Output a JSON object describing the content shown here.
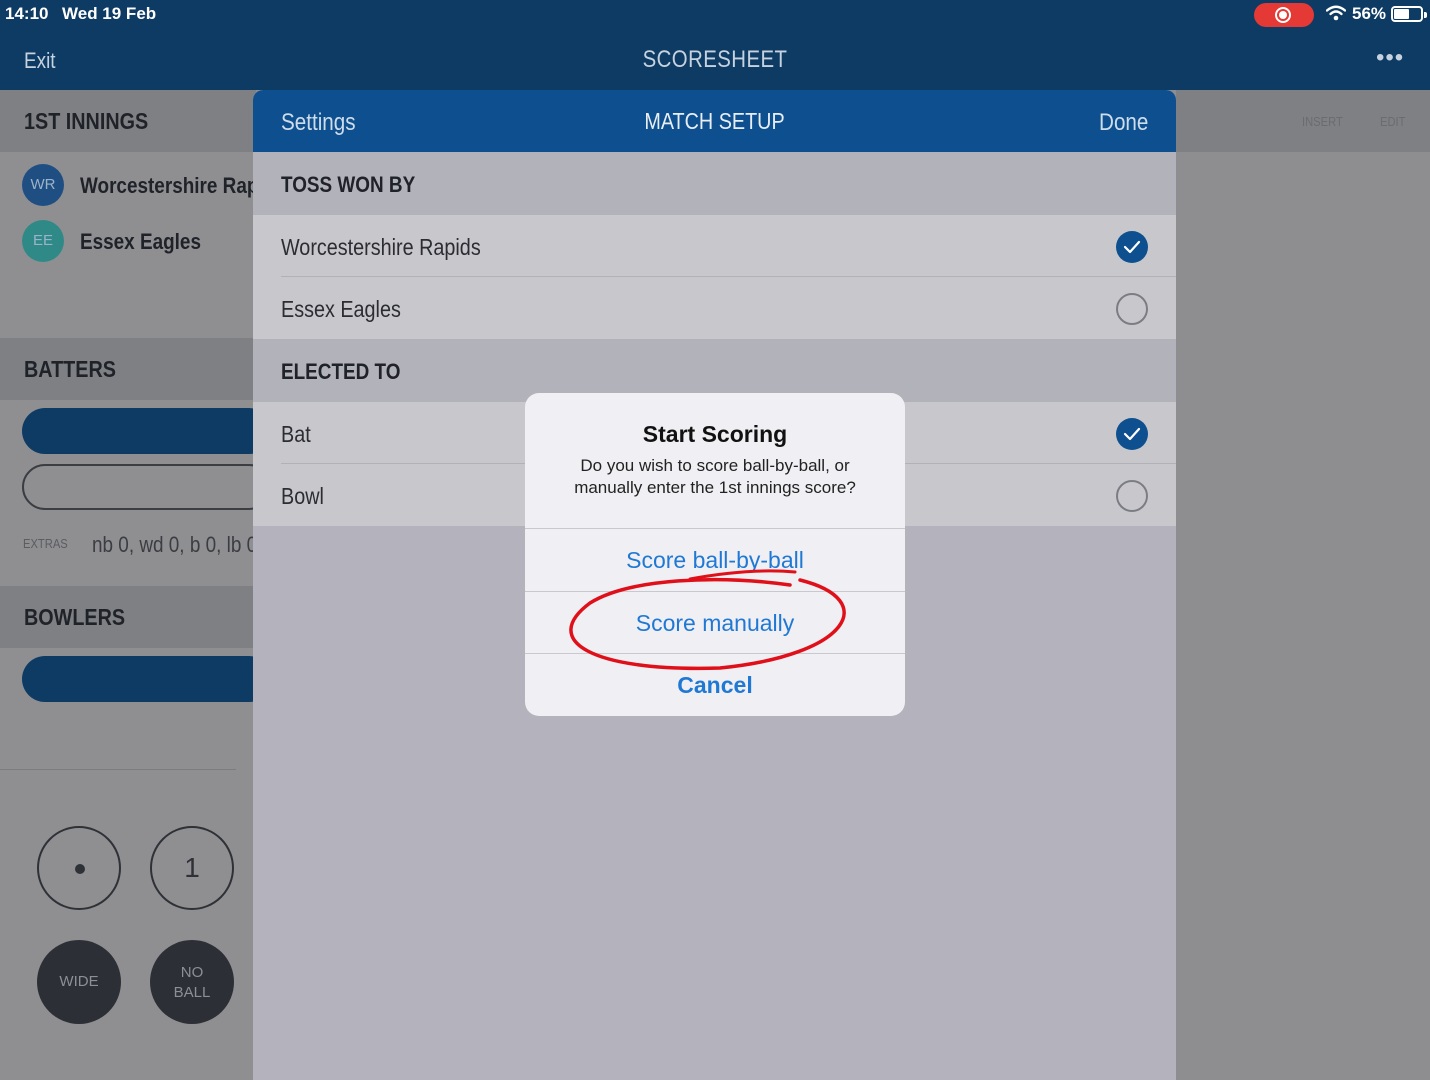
{
  "status_bar": {
    "time": "14:10",
    "date": "Wed 19 Feb",
    "battery": "56%"
  },
  "nav": {
    "exit": "Exit",
    "title": "SCORESHEET",
    "more": "•••"
  },
  "left_panel": {
    "innings_header": "1ST INNINGS",
    "teams": [
      {
        "initials": "WR",
        "name": "Worcestershire Rap",
        "color": "#1f4f82"
      },
      {
        "initials": "EE",
        "name": "Essex Eagles",
        "color": "#2f8a87"
      }
    ],
    "batters_header": "BATTERS",
    "extras_label": "EXTRAS",
    "extras_value": "nb 0, wd 0, b 0, lb 0",
    "bowlers_header": "BOWLERS",
    "pad": {
      "one": "1",
      "wide": "WIDE",
      "no_ball_line1": "NO",
      "no_ball_line2": "BALL"
    }
  },
  "right_header": {
    "insert": "INSERT",
    "edit": "EDIT"
  },
  "match_setup": {
    "settings": "Settings",
    "title": "MATCH SETUP",
    "done": "Done",
    "toss_header": "TOSS WON BY",
    "toss_options": [
      {
        "label": "Worcestershire Rapids",
        "checked": true
      },
      {
        "label": "Essex Eagles",
        "checked": false
      }
    ],
    "elected_header": "ELECTED TO",
    "elected_options": [
      {
        "label": "Bat",
        "checked": true
      },
      {
        "label": "Bowl",
        "checked": false
      }
    ]
  },
  "alert": {
    "title": "Start Scoring",
    "message": "Do you wish to score ball-by-ball, or manually enter the 1st innings score?",
    "buttons": {
      "ball_by_ball": "Score ball-by-ball",
      "manually": "Score manually",
      "cancel": "Cancel"
    }
  },
  "colors": {
    "nav_dark": "#0e3b63",
    "sheet_header": "#0e508f",
    "alert_button": "#1f79d4",
    "annotation": "#e0101a"
  }
}
